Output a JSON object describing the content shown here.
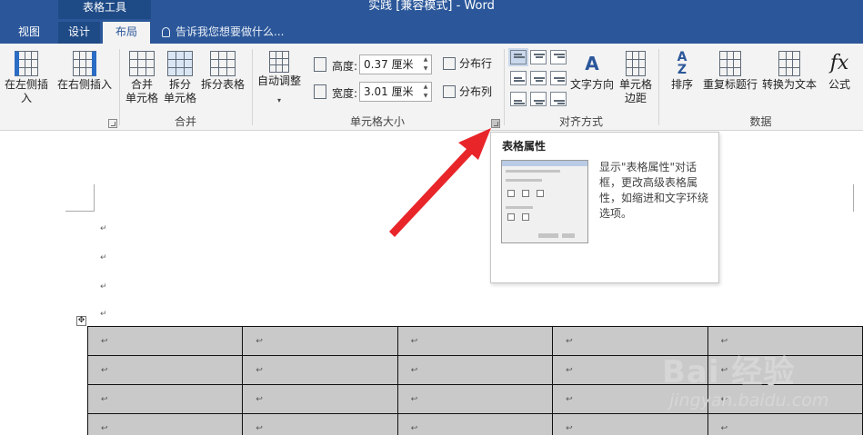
{
  "window": {
    "context_tab_group": "表格工具",
    "title": "实践 [兼容模式] - Word"
  },
  "tabs": [
    {
      "label": "视图"
    },
    {
      "label": "设计"
    },
    {
      "label": "布局"
    }
  ],
  "tell_me": {
    "placeholder": "告诉我您想要做什么..."
  },
  "ribbon": {
    "rows_cols": {
      "insert_left": "在左侧插入",
      "insert_right": "在右侧插入"
    },
    "merge": {
      "merge_cells_1": "合并",
      "merge_cells_2": "单元格",
      "split_cells_1": "拆分",
      "split_cells_2": "单元格",
      "split_table": "拆分表格",
      "group_label": "合并"
    },
    "cell_size": {
      "autofit": "自动调整",
      "height_label": "高度:",
      "height_value": "0.37 厘米",
      "width_label": "宽度:",
      "width_value": "3.01 厘米",
      "distribute_rows": "分布行",
      "distribute_cols": "分布列",
      "group_label": "单元格大小"
    },
    "alignment": {
      "text_direction_1": "文字方向",
      "cell_margins_1": "单元格",
      "cell_margins_2": "边距",
      "group_label": "对齐方式"
    },
    "data": {
      "sort": "排序",
      "repeat_header": "重复标题行",
      "convert_to_text": "转换为文本",
      "formula": "公式",
      "group_label": "数据"
    }
  },
  "tooltip": {
    "title": "表格属性",
    "description": "显示\"表格属性\"对话框，更改高级表格属性，如缩进和文字环绕选项。"
  },
  "document": {
    "paragraph_mark": "↵",
    "table_cell_mark": "↩"
  },
  "watermark": {
    "brand": "Bai 经验",
    "url": "jingyan.baidu.com"
  },
  "colors": {
    "ribbon_blue": "#2b579a",
    "arrow_red": "#e8262a",
    "table_shading": "#c9c9c9"
  }
}
